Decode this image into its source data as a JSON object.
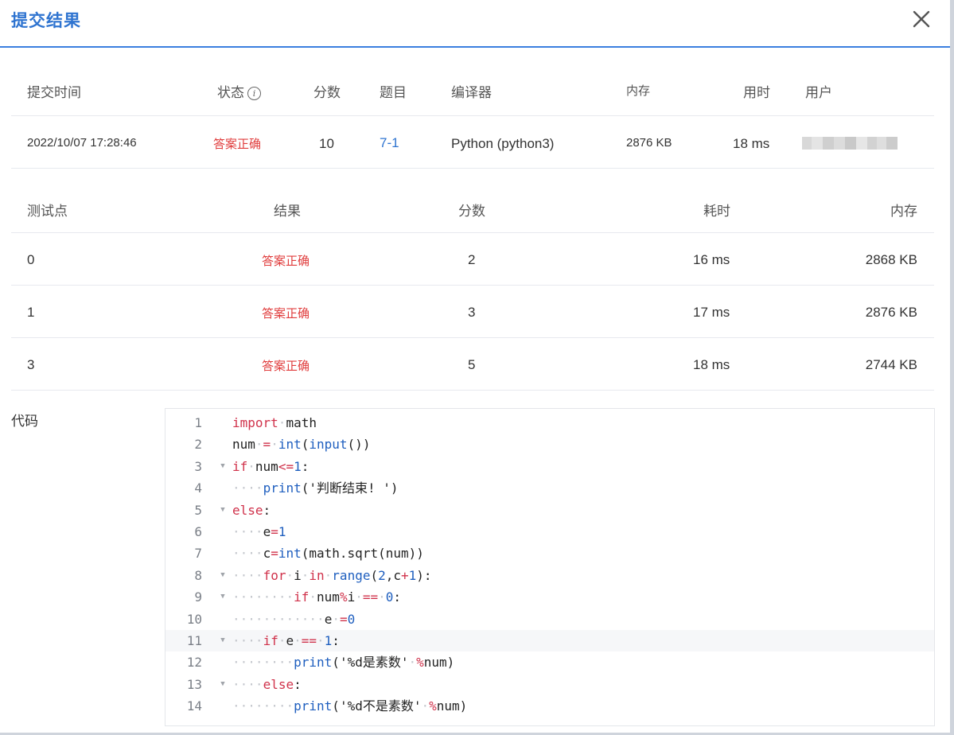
{
  "dialog": {
    "title": "提交结果"
  },
  "submission": {
    "headers": {
      "time": "提交时间",
      "status": "状态",
      "score": "分数",
      "problem": "题目",
      "compiler": "编译器",
      "memory": "内存",
      "duration": "用时",
      "user": "用户"
    },
    "status_info_icon": "info-icon",
    "row": {
      "time": "2022/10/07 17:28:46",
      "status": "答案正确",
      "score": "10",
      "problem": "7-1",
      "compiler": "Python (python3)",
      "memory": "2876 KB",
      "duration": "18 ms",
      "user": ""
    }
  },
  "testcases": {
    "headers": {
      "case": "测试点",
      "result": "结果",
      "score": "分数",
      "time": "耗时",
      "memory": "内存"
    },
    "rows": [
      {
        "case": "0",
        "result": "答案正确",
        "score": "2",
        "time": "16 ms",
        "memory": "2868 KB"
      },
      {
        "case": "1",
        "result": "答案正确",
        "score": "3",
        "time": "17 ms",
        "memory": "2876 KB"
      },
      {
        "case": "3",
        "result": "答案正确",
        "score": "5",
        "time": "18 ms",
        "memory": "2744 KB"
      }
    ]
  },
  "code": {
    "label": "代码",
    "highlighted_line": 11,
    "lines": [
      "import math",
      "num = int(input())",
      "if num<=1:",
      "    print('判断结束! ')",
      "else:",
      "    e=1",
      "    c=int(math.sqrt(num))",
      "    for i in range(2,c+1):",
      "        if num%i == 0:",
      "            e =0",
      "    if e == 1:",
      "        print('%d是素数' %num)",
      "    else:",
      "        print('%d不是素数' %num)"
    ],
    "line_numbers": [
      "1",
      "2",
      "3",
      "4",
      "5",
      "6",
      "7",
      "8",
      "9",
      "10",
      "11",
      "12",
      "13",
      "14"
    ],
    "foldable_lines": [
      3,
      5,
      8,
      9,
      11,
      13
    ]
  },
  "colors": {
    "accent": "#2f74d0",
    "status_ok": "#e03c3c",
    "keyword": "#d0324b",
    "builtin": "#1f5fbf"
  }
}
